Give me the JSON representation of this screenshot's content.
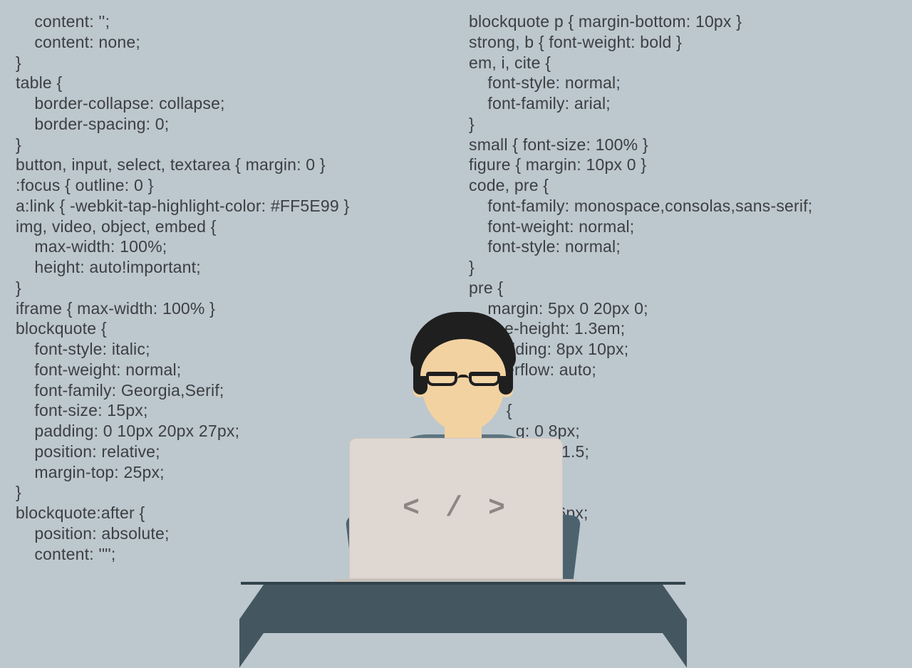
{
  "left_code": "    content: '';\n    content: none;\n}\ntable {\n    border-collapse: collapse;\n    border-spacing: 0;\n}\nbutton, input, select, textarea { margin: 0 }\n:focus { outline: 0 }\na:link { -webkit-tap-highlight-color: #FF5E99 }\nimg, video, object, embed {\n    max-width: 100%;\n    height: auto!important;\n}\niframe { max-width: 100% }\nblockquote {\n    font-style: italic;\n    font-weight: normal;\n    font-family: Georgia,Serif;\n    font-size: 15px;\n    padding: 0 10px 20px 27px;\n    position: relative;\n    margin-top: 25px;\n}\nblockquote:after {\n    position: absolute;\n    content: '\"';",
  "right_code": "blockquote p { margin-bottom: 10px }\nstrong, b { font-weight: bold }\nem, i, cite {\n    font-style: normal;\n    font-family: arial;\n}\nsmall { font-size: 100% }\nfigure { margin: 10px 0 }\ncode, pre {\n    font-family: monospace,consolas,sans-serif;\n    font-weight: normal;\n    font-style: normal;\n}\npre {\n    margin: 5px 0 20px 0;\n    line-height: 1.3em;\n    padding: 8px 10px;\n    overflow: auto;\n}\n        {\n          g: 0 8px;\n          eight: 1.5;\n\n       {\n          : 1px 6px;\n          0 2px;\n          ack:",
  "laptop_symbol": "< / >"
}
